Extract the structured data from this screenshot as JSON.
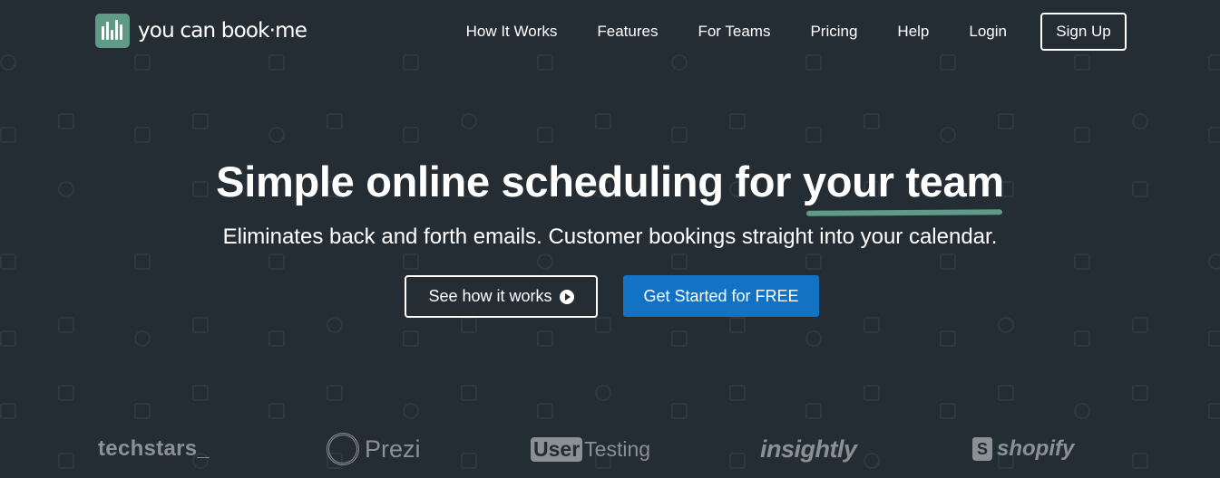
{
  "brand": {
    "logo_text": "you can book·me",
    "accent_color": "#5e9a85"
  },
  "nav": {
    "items": [
      {
        "label": "How It Works"
      },
      {
        "label": "Features"
      },
      {
        "label": "For Teams"
      },
      {
        "label": "Pricing"
      },
      {
        "label": "Help"
      },
      {
        "label": "Login"
      }
    ],
    "signup_label": "Sign Up"
  },
  "hero": {
    "headline_prefix": "Simple online scheduling for ",
    "headline_highlight": "your team",
    "subline": "Eliminates back and forth emails. Customer bookings straight into your calendar.",
    "secondary_cta": "See how it works",
    "secondary_cta_icon": "play-circle-icon",
    "primary_cta": "Get Started for FREE",
    "primary_color": "#1272c4"
  },
  "customers": [
    {
      "name": "techstars_"
    },
    {
      "name": "Prezi"
    },
    {
      "name_box": "User",
      "name_rest": "Testing"
    },
    {
      "name": "insightly"
    },
    {
      "name": "shopify"
    }
  ],
  "colors": {
    "background": "#252d34",
    "text": "#ffffff",
    "logo_gray": "#8a9096"
  }
}
